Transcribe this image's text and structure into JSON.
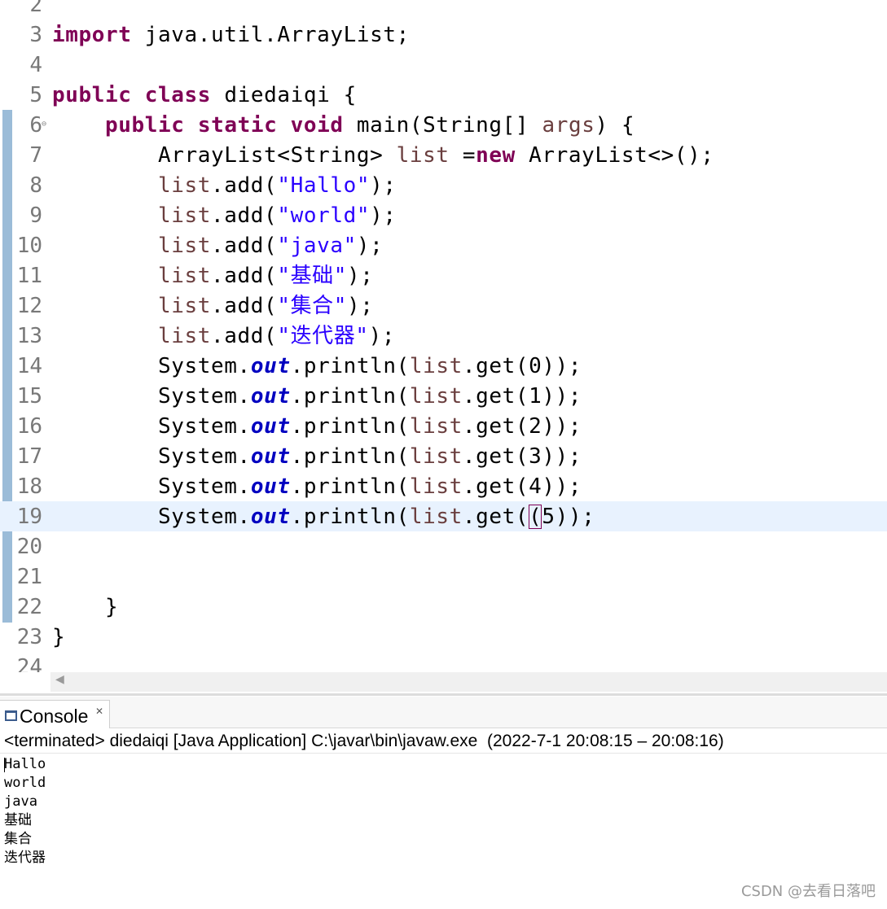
{
  "editor": {
    "line_numbers": [
      "2",
      "3",
      "4",
      "5",
      "6",
      "7",
      "8",
      "9",
      "10",
      "11",
      "12",
      "13",
      "14",
      "15",
      "16",
      "17",
      "18",
      "19",
      "20",
      "21",
      "22",
      "23",
      "24"
    ],
    "tokens": {
      "import_kw": "import",
      "import_path": " java.util.ArrayList;",
      "public_kw": "public",
      "class_kw": "class",
      "class_name": " diedaiqi {",
      "static_kw": "static",
      "void_kw": "void",
      "main_sig": " main(String[] ",
      "args": "args",
      "main_close": ") {",
      "list_type": "ArrayList<String> ",
      "list_var": "list",
      "assign": " =",
      "new_kw": "new",
      "ctor": " ArrayList<>();",
      "add_call": ".add(",
      "add_close": ");",
      "system": "System.",
      "out_field": "out",
      "println_open": ".println(",
      "get_open": ".get(",
      "paren_open": "(",
      "num_5": "5",
      "get_close": "));",
      "close_brace": "}"
    },
    "strings": [
      "\"Hallo\"",
      "\"world\"",
      "\"java\"",
      "\"基础\"",
      "\"集合\"",
      "\"迭代器\""
    ],
    "indices": [
      "0",
      "1",
      "2",
      "3",
      "4"
    ]
  },
  "console": {
    "tab_label": "Console",
    "close_glyph": "✕",
    "status": "<terminated> diedaiqi [Java Application] C:\\javar\\bin\\javaw.exe  (2022-7-1 20:08:15 – 20:08:16)",
    "output": [
      "Hallo",
      "world",
      "java",
      "基础",
      "集合",
      "迭代器"
    ]
  },
  "watermark": "CSDN @去看日落吧"
}
